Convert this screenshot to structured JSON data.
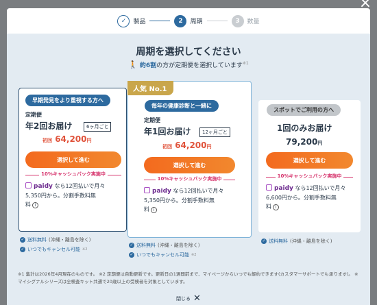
{
  "close_glyph": "×",
  "stepper": {
    "steps": [
      {
        "num": "✓",
        "label": "製品"
      },
      {
        "num": "2",
        "label": "周期"
      },
      {
        "num": "3",
        "label": "数量"
      }
    ]
  },
  "heading": "周期を選択してください",
  "subheading": {
    "prefix": "約",
    "highlight": "6割",
    "suffix": "の方が定期便を選択しています",
    "note": "※1"
  },
  "cards": [
    {
      "ribbon": "早期発見をより重視する方へ",
      "plan_small": "定期便",
      "plan_big": "年2回お届け",
      "cycle": "6ヶ月ごと",
      "first_label": "初回",
      "price": "64,200",
      "yen": "円",
      "cta": "選択して進む",
      "cashback": "10%キャッシュバック実施中",
      "paidy_logo": "paidy",
      "paidy_text1": "なら12回払いで月々",
      "paidy_text2": "5,350円から。分割手数料無",
      "paidy_text3": "料",
      "benefits": [
        {
          "text": "送料無料",
          "muted": "(沖縄・離島を除く)",
          "sup": ""
        },
        {
          "text": "いつでもキャンセル可能",
          "muted": "",
          "sup": "※2"
        }
      ]
    },
    {
      "popular": "人気 No.1",
      "ribbon": "毎年の健康診断と一緒に",
      "plan_small": "定期便",
      "plan_big": "年1回お届け",
      "cycle": "12ヶ月ごと",
      "first_label": "初回",
      "price": "64,200",
      "yen": "円",
      "cta": "選択して進む",
      "cashback": "10%キャッシュバック実施中",
      "paidy_logo": "paidy",
      "paidy_text1": "なら12回払いで月々",
      "paidy_text2": "5,350円から。分割手数料無",
      "paidy_text3": "料",
      "benefits": [
        {
          "text": "送料無料",
          "muted": "(沖縄・離島を除く)",
          "sup": ""
        },
        {
          "text": "いつでもキャンセル可能",
          "muted": "",
          "sup": "※2"
        }
      ]
    },
    {
      "ribbon": "スポットでご利用の方へ",
      "plan_big": "1回のみお届け",
      "price": "79,200",
      "yen": "円",
      "cta": "選択して進む",
      "cashback": "10%キャッシュバック実施中",
      "paidy_logo": "paidy",
      "paidy_text1": "なら12回払いで月々",
      "paidy_text2": "6,600円から。分割手数料無",
      "paidy_text3": "料",
      "benefits": [
        {
          "text": "送料無料",
          "muted": "(沖縄・離島を除く)",
          "sup": ""
        }
      ]
    }
  ],
  "notes": {
    "line1": "※1 集計は2026年4月現在のものです。 ※2 定期便は自動更新です。更新日の1週間前まで、マイページからいつでも解約できます(カスタマーサポートでも承ります)。 ※ マイシグナルシリーズは全検査キット共通で20歳以上の受検者を対象としています。"
  },
  "close_label": "閉じる",
  "close_icon": "✕"
}
